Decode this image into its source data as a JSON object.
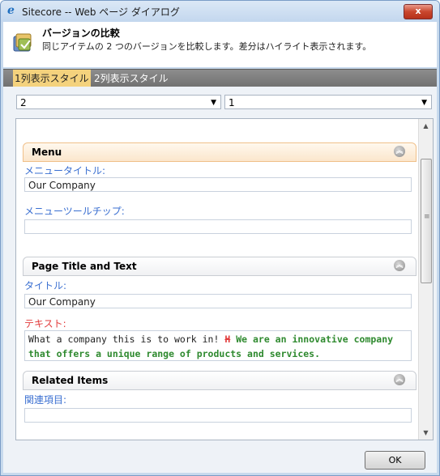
{
  "window": {
    "title": "Sitecore -- Web ページ ダイアログ",
    "close_label": "x"
  },
  "header": {
    "title": "バージョンの比較",
    "description": "同じアイテムの 2 つのバージョンを比較します。差分はハイライト表示されます。",
    "icon": "version-compare-icon"
  },
  "tabs": [
    {
      "label": "1列表示スタイル",
      "active": true
    },
    {
      "label": "2列表示スタイル",
      "active": false
    }
  ],
  "version_selectors": [
    {
      "value": "2"
    },
    {
      "value": "1"
    }
  ],
  "sections": [
    {
      "title": "Menu",
      "fields": [
        {
          "label": "メニュータイトル:",
          "value": "Our Company"
        },
        {
          "label": "メニューツールチップ:",
          "value": ""
        }
      ]
    },
    {
      "title": "Page Title and Text",
      "fields": [
        {
          "label": "タイトル:",
          "value": "Our Company"
        },
        {
          "label": "テキスト:",
          "changed": true,
          "value_original": "What a company this is to work in!",
          "deleted_marker": "H",
          "value_added": "We are an innovative company that offers a unique range of products and services."
        }
      ]
    },
    {
      "title": "Related Items",
      "fields": [
        {
          "label": "関連項目:",
          "value": ""
        }
      ]
    }
  ],
  "footer": {
    "ok_label": "OK"
  },
  "colors": {
    "field_label": "#3a6fd1",
    "changed_label": "#e23c3c",
    "added_text": "#2f8a2f",
    "active_tab": "#f4d27d"
  }
}
